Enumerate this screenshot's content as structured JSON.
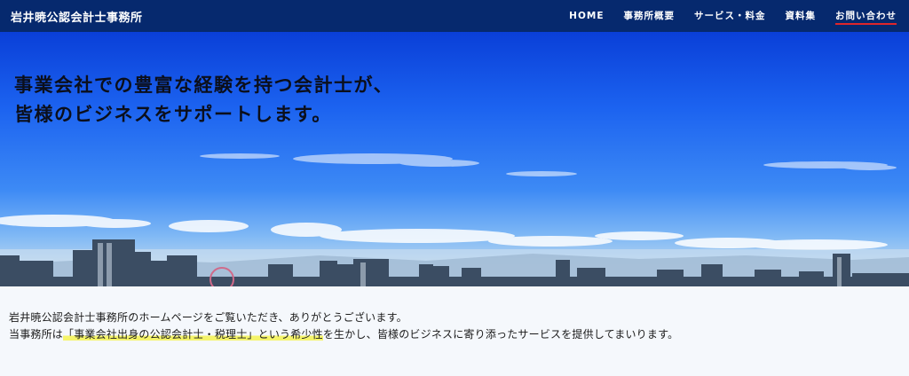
{
  "header": {
    "site_title": "岩井暁公認会計士事務所",
    "nav": [
      {
        "label": "HOME"
      },
      {
        "label": "事務所概要"
      },
      {
        "label": "サービス・料金"
      },
      {
        "label": "資料集"
      },
      {
        "label": "お問い合わせ",
        "active": true
      }
    ]
  },
  "hero": {
    "heading_line1": "事業会社での豊富な経験を持つ会計士が、",
    "heading_line2": "皆様のビジネスをサポートします。"
  },
  "intro": {
    "line1": "岩井暁公認会計士事務所のホームページをご覧いただき、ありがとうございます。",
    "line2_prefix": "当事務所は",
    "line2_highlight": "「事業会社出身の公認会計士・税理士」という希少性",
    "line2_suffix": "を生かし、皆様のビジネスに寄り添ったサービスを提供してまいります。"
  },
  "colors": {
    "header_bg": "#06296e",
    "nav_active_underline": "#e0262b",
    "highlight": "#f5f46a"
  }
}
